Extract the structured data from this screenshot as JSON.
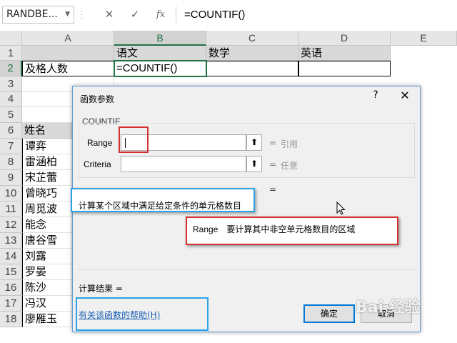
{
  "formula_bar": {
    "name_box": "RANDBE...",
    "cancel_icon": "✕",
    "enter_icon": "✓",
    "fx_icon": "fx",
    "formula": "=COUNTIF()"
  },
  "columns": [
    "A",
    "B",
    "C",
    "D",
    "E"
  ],
  "rows": [
    "1",
    "2",
    "3",
    "4",
    "5",
    "6",
    "7",
    "8",
    "9",
    "10",
    "11",
    "12",
    "13",
    "14",
    "15",
    "16",
    "17",
    "18"
  ],
  "cells": {
    "B1": "语文",
    "C1": "数学",
    "D1": "英语",
    "A2": "及格人数",
    "B2": "=COUNTIF()",
    "A6": "姓名",
    "names": [
      "谭弈",
      "雷涵柏",
      "宋芷蕾",
      "曾晓巧",
      "周觅波",
      "能念",
      "唐谷雪",
      "刘露",
      "罗晏",
      "陈沙",
      "冯汉",
      "廖雁玉"
    ]
  },
  "dialog": {
    "title": "函数参数",
    "help_button": "?",
    "close_button": "✕",
    "function_name": "COUNTIF",
    "args": [
      {
        "label": "Range",
        "value": "",
        "eq": "=",
        "hint": "引用"
      },
      {
        "label": "Criteria",
        "value": "",
        "eq": "=",
        "hint": "任意"
      }
    ],
    "result_equals": "=",
    "description": "计算某个区域中满足给定条件的单元格数目",
    "arg_description_name": "Range",
    "arg_description_text": "要计算其中非空单元格数目的区域",
    "calc_result_label": "计算结果 =",
    "help_link": "有关该函数的帮助(H)",
    "ok_button": "确定",
    "cancel_button": "取消"
  },
  "watermark": "Bai 经验",
  "colors": {
    "accent_green": "#217346",
    "annotation_red": "#d32f2f",
    "annotation_blue": "#29a3e6",
    "header_gray": "#d9d9d9"
  }
}
